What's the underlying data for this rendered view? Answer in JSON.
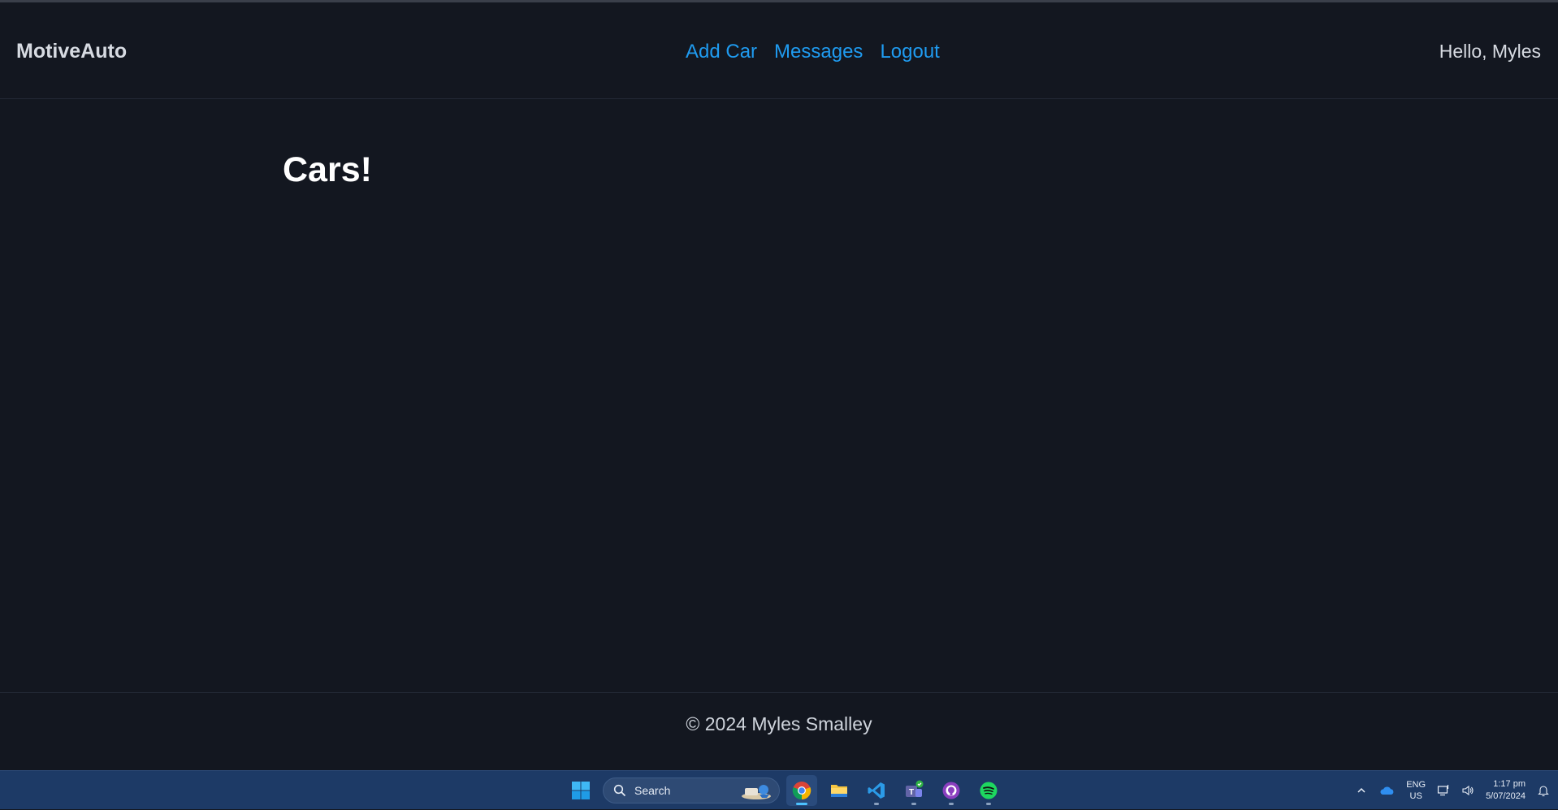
{
  "app": {
    "brand": "MotiveAuto",
    "nav": [
      {
        "label": "Add Car"
      },
      {
        "label": "Messages"
      },
      {
        "label": "Logout"
      }
    ],
    "greeting": "Hello, Myles"
  },
  "main": {
    "title": "Cars!"
  },
  "footer": {
    "text": "© 2024 Myles Smalley"
  },
  "taskbar": {
    "search_label": "Search",
    "apps": [
      "start-icon",
      "chrome-icon",
      "file-explorer-icon",
      "vscode-icon",
      "teams-icon",
      "github-desktop-icon",
      "spotify-icon"
    ],
    "language_top": "ENG",
    "language_bottom": "US",
    "time": "1:17 pm",
    "date": "5/07/2024"
  },
  "colors": {
    "background": "#131720",
    "link": "#1f9bf0",
    "taskbar": "#1d3a66"
  }
}
